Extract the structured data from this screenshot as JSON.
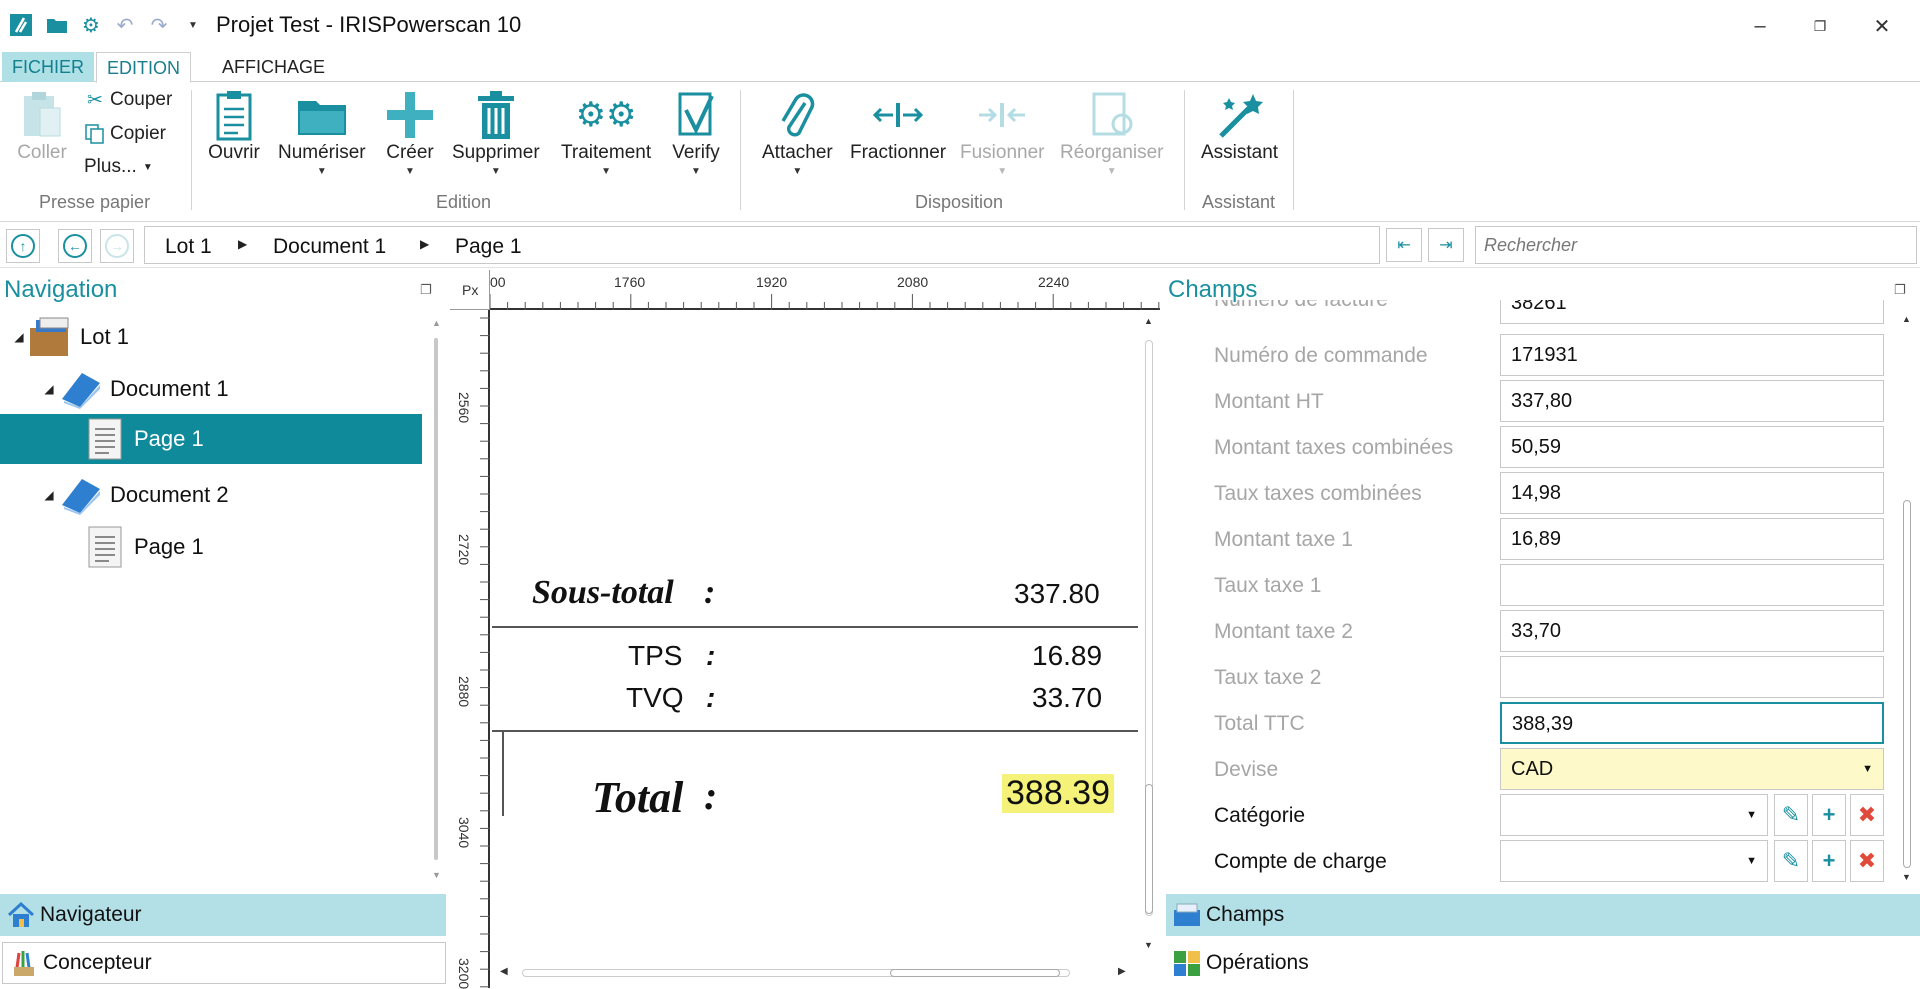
{
  "window": {
    "title": "Projet Test - IRISPowerscan 10"
  },
  "ribbon_tabs": {
    "fichier": "FICHIER",
    "edition": "EDITION",
    "affichage": "AFFICHAGE"
  },
  "ribbon": {
    "presse_papier": {
      "coller": "Coller",
      "couper": "Couper",
      "copier": "Copier",
      "plus": "Plus...",
      "group": "Presse papier"
    },
    "edition": {
      "ouvrir": "Ouvrir",
      "numeriser": "Numériser",
      "creer": "Créer",
      "supprimer": "Supprimer",
      "traitement": "Traitement",
      "verify": "Verify",
      "group": "Edition"
    },
    "disposition": {
      "attacher": "Attacher",
      "fractionner": "Fractionner",
      "fusionner": "Fusionner",
      "reorganiser": "Réorganiser",
      "group": "Disposition"
    },
    "assistant": {
      "assistant": "Assistant",
      "group": "Assistant"
    }
  },
  "breadcrumb": {
    "items": [
      "Lot 1",
      "Document 1",
      "Page 1"
    ]
  },
  "search": {
    "placeholder": "Rechercher"
  },
  "navigation": {
    "title": "Navigation",
    "tree": [
      {
        "label": "Lot 1"
      },
      {
        "label": "Document 1"
      },
      {
        "label": "Page 1"
      },
      {
        "label": "Document 2"
      },
      {
        "label": "Page 1"
      }
    ],
    "bottom_tabs": {
      "navigateur": "Navigateur",
      "concepteur": "Concepteur"
    }
  },
  "viewer": {
    "ruler_unit": "Px",
    "h_ticks": [
      "00",
      "1760",
      "1920",
      "2080",
      "2240"
    ],
    "v_ticks": [
      "2560",
      "2720",
      "2880",
      "3040",
      "3200"
    ],
    "doc": {
      "sous_total_label": "Sous-total",
      "sous_total_value": "337.80",
      "tps_label": "TPS",
      "tps_value": "16.89",
      "tvq_label": "TVQ",
      "tvq_value": "33.70",
      "total_label": "Total",
      "total_value": "388.39",
      "colon": ":"
    }
  },
  "champs": {
    "title": "Champs",
    "fields": [
      {
        "label": "Numéro de facture",
        "value": "38261"
      },
      {
        "label": "Numéro de commande",
        "value": "171931"
      },
      {
        "label": "Montant HT",
        "value": "337,80"
      },
      {
        "label": "Montant taxes combinées",
        "value": "50,59"
      },
      {
        "label": "Taux taxes combinées",
        "value": "14,98"
      },
      {
        "label": "Montant taxe 1",
        "value": "16,89"
      },
      {
        "label": "Taux taxe 1",
        "value": ""
      },
      {
        "label": "Montant taxe 2",
        "value": "33,70"
      },
      {
        "label": "Taux taxe 2",
        "value": ""
      },
      {
        "label": "Total TTC",
        "value": "388,39"
      },
      {
        "label": "Devise",
        "value": "CAD"
      },
      {
        "label": "Catégorie",
        "value": ""
      },
      {
        "label": "Compte de charge",
        "value": ""
      }
    ],
    "bottom_tabs": {
      "champs": "Champs",
      "operations": "Opérations"
    }
  },
  "colors": {
    "accent": "#1a8fa0",
    "selection": "#0f8a9a",
    "highlight": "#f5f27a",
    "tab_active": "#b3e0e6"
  }
}
